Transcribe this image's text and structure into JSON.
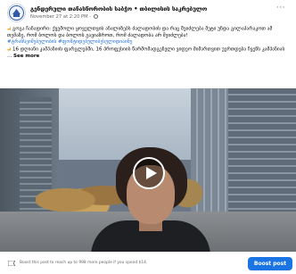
{
  "post": {
    "page_name": "გენდერული თანასწორობის საბჭო • თბილისის საკრებულო",
    "timestamp": "November 27 at 2:20 PM · ",
    "more_label": "···",
    "text_line1": "გოგა ჩანადირი: ქვემოლი ყოველთვის ანალიზებს ძალადობის და რაც შეიძლება მეტი უნდა გილაპარაკოთ ამ თემაზე, რომ ბოლოს და ბოლოს გავიაზროთ, რომ ძალადობა არ შეიძლება!",
    "hashtags": "#ტრანსეიშებულიბის #ფოშტიდებულიბესულიდიაინუ",
    "text_line2": "16 დღიანი კამპანიის ფარგლებში, 16 პროფესიის წარმომადგენელი ვიდეო მიმართვით უერთდება ჩვენს კამპანიას ...",
    "see_more": "See more"
  },
  "boost": {
    "text": "Boost this post to reach up to 998 more people if you spend $14.",
    "button_label": "Boost post"
  },
  "colors": {
    "accent": "#1b74e4",
    "hashtag": "#216fdb",
    "emoji": "#f5a623"
  },
  "icons": {
    "avatar": "council-logo-icon",
    "play": "play-icon",
    "boost": "boost-icon",
    "globe": "globe-icon"
  }
}
